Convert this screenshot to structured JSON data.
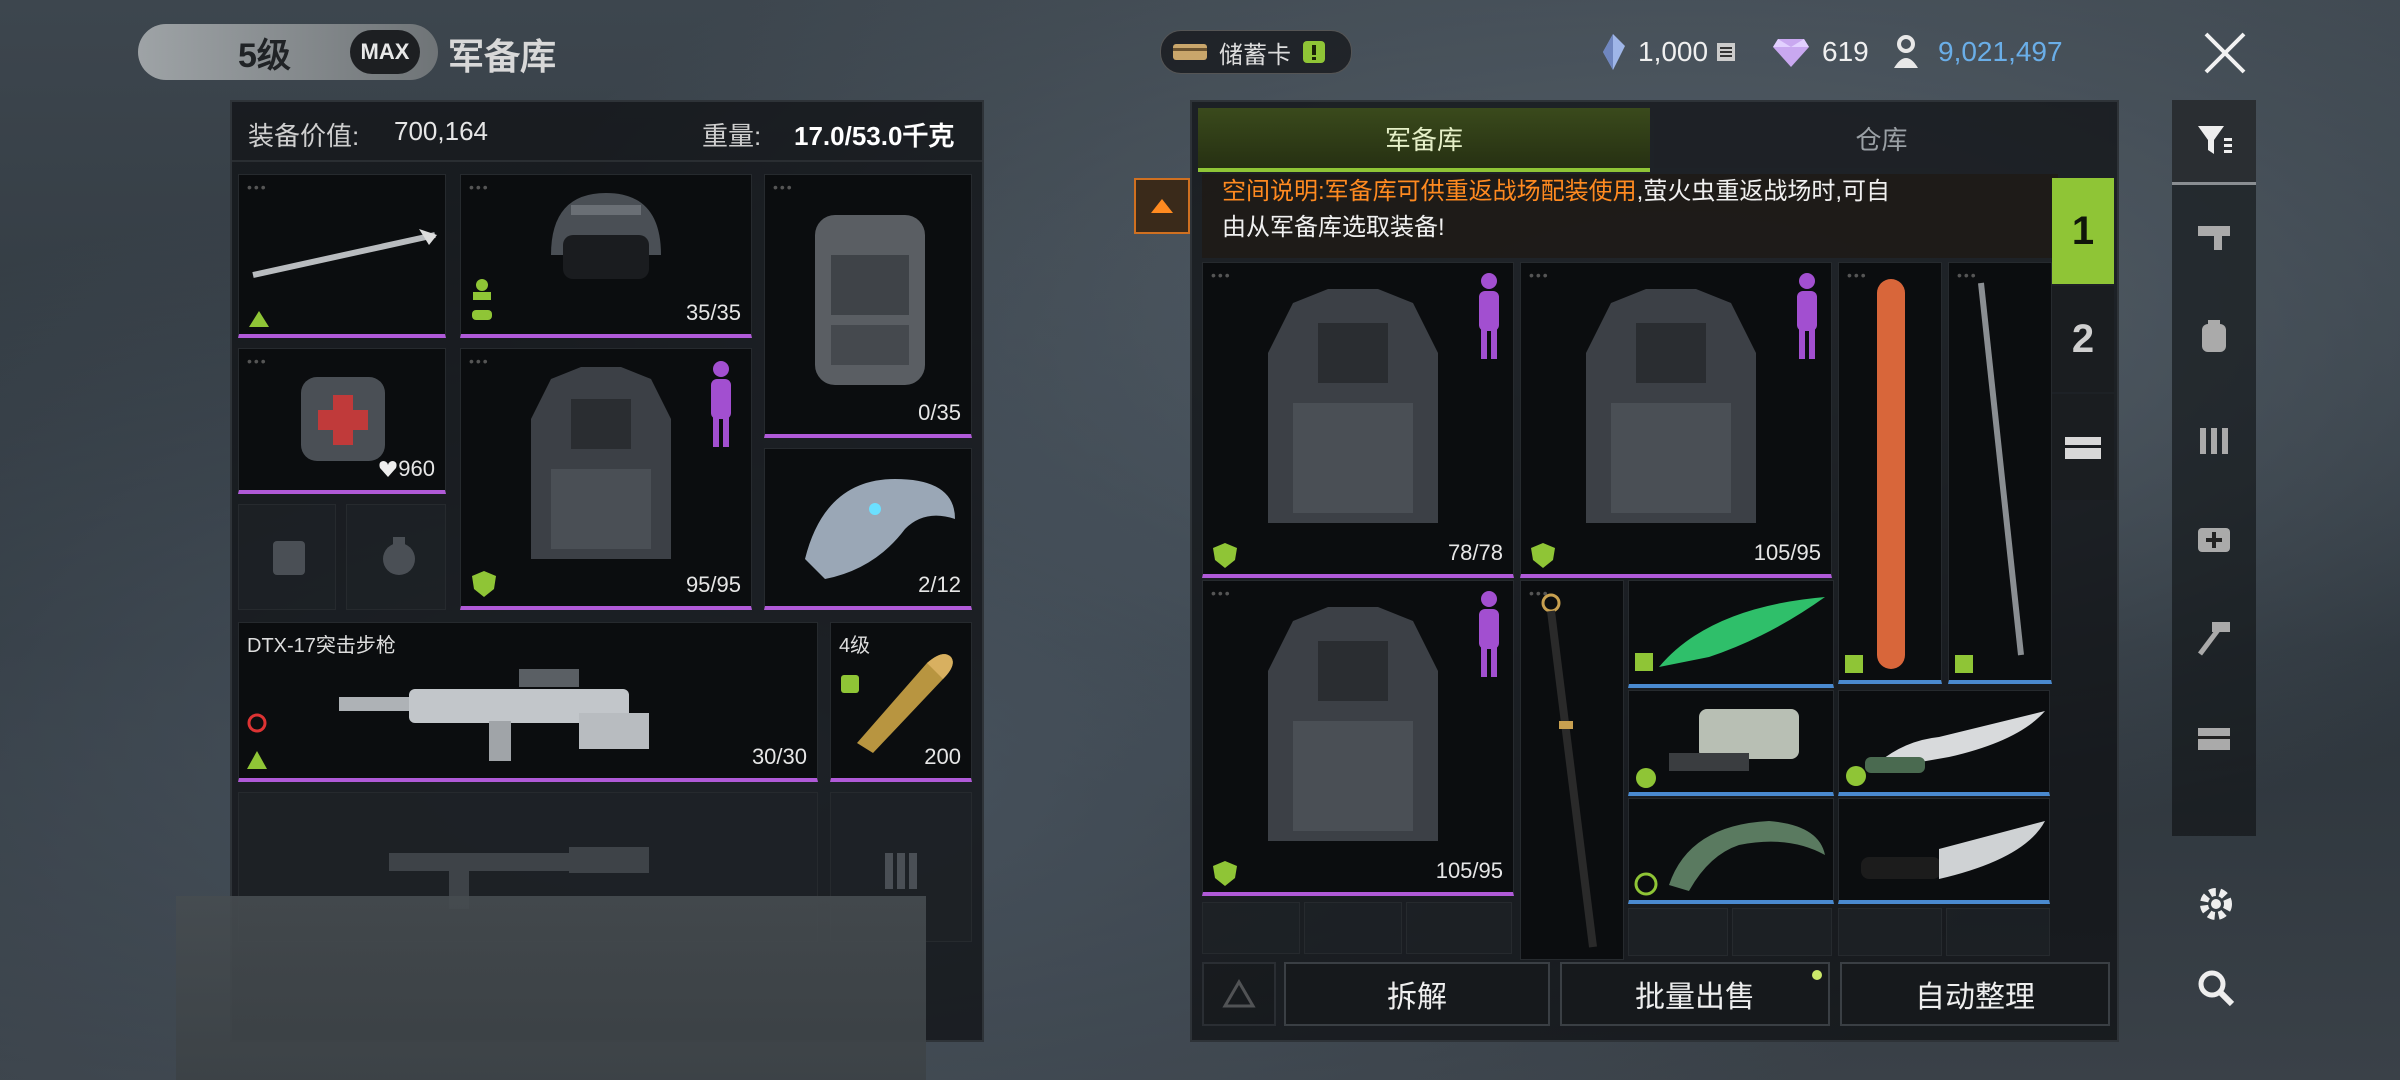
{
  "header": {
    "level": "5级",
    "max_label": "MAX",
    "title": "军备库",
    "savings_card": "储蓄卡",
    "currency_tickets": "1,000",
    "currency_diamonds": "619",
    "currency_coins": "9,021,497",
    "colors": {
      "accent": "#8fc536",
      "coins": "#6aaee8",
      "rarity_purple": "#b05ad8",
      "rarity_blue": "#4a8ad0"
    }
  },
  "loadout": {
    "value_label": "装备价值:",
    "value": "700,164",
    "weight_label": "重量:",
    "weight": "17.0/53.0千克",
    "helmet_qty": "35/35",
    "backpack_qty": "0/35",
    "medkit_qty": "960",
    "armor_qty": "95/95",
    "pet_qty": "2/12",
    "primary_weapon_name": "DTX-17突击步枪",
    "primary_weapon_ammo": "30/30",
    "ammo_level": "4级",
    "ammo_qty": "200"
  },
  "armory": {
    "tab_armory": "军备库",
    "tab_warehouse": "仓库",
    "notice_highlight": "空间说明:军备库可供重返战场配装使用",
    "notice_rest_line1": ",萤火虫重返战场时,可自",
    "notice_rest_line2": "由从军备库选取装备!",
    "page_1": "1",
    "page_2": "2",
    "vest_1_qty": "78/78",
    "vest_2_qty": "105/95",
    "vest_3_qty": "105/95",
    "btn_dismantle": "拆解",
    "btn_bulk_sell": "批量出售",
    "btn_auto_sort": "自动整理"
  }
}
